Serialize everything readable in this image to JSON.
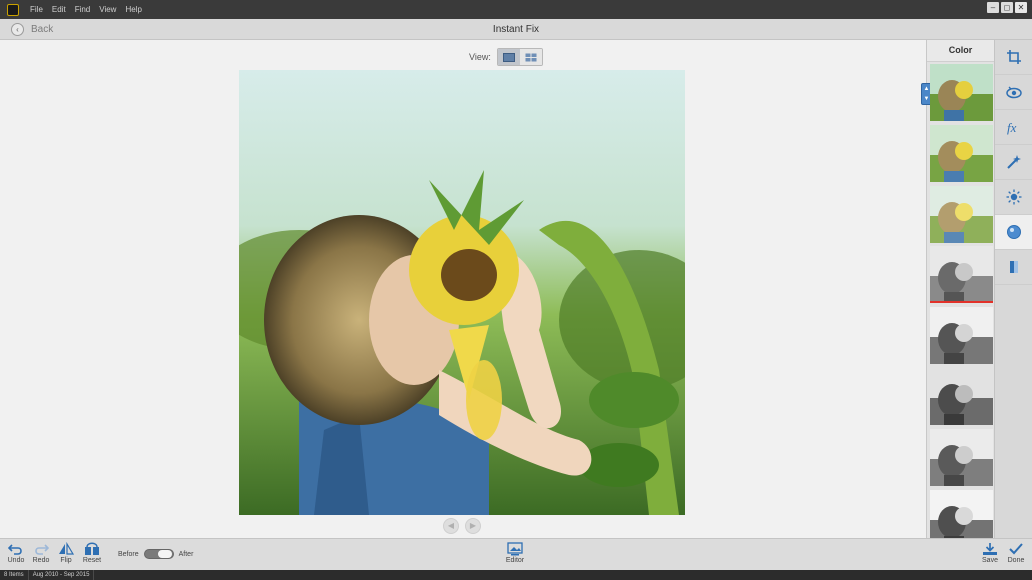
{
  "menubar": {
    "items": [
      "File",
      "Edit",
      "Find",
      "View",
      "Help"
    ]
  },
  "header": {
    "back_label": "Back",
    "title": "Instant Fix"
  },
  "view": {
    "label": "View:",
    "options": [
      "single-view-icon",
      "grid-view-icon"
    ],
    "active": 0
  },
  "panel": {
    "title": "Color",
    "thumbnail_count": 8,
    "selected_index": 3
  },
  "tools": [
    "crop-icon",
    "red-eye-icon",
    "fx-icon",
    "smart-fix-icon",
    "light-icon",
    "color-icon",
    "clarity-icon"
  ],
  "active_tool": 5,
  "bottom": {
    "undo": "Undo",
    "redo": "Redo",
    "flip": "Flip",
    "reset": "Reset",
    "before": "Before",
    "after": "After",
    "editor": "Editor",
    "save": "Save",
    "done": "Done"
  },
  "status": {
    "items": "8 Items",
    "date_range": "Aug 2010 - Sep 2015"
  },
  "colors": {
    "accent": "#2e6fb3",
    "selected_marker": "#e2322a"
  }
}
